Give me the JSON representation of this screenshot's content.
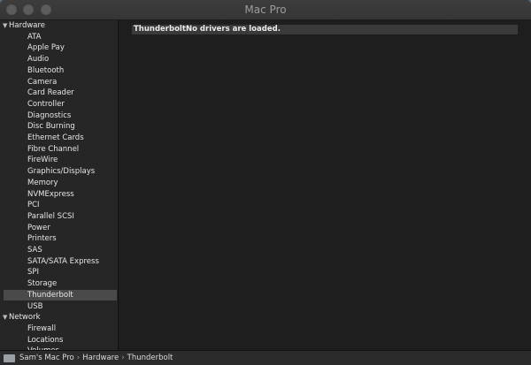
{
  "window": {
    "title": "Mac Pro"
  },
  "sidebar": {
    "groups": [
      {
        "label": "Hardware",
        "expanded": true,
        "items": [
          "ATA",
          "Apple Pay",
          "Audio",
          "Bluetooth",
          "Camera",
          "Card Reader",
          "Controller",
          "Diagnostics",
          "Disc Burning",
          "Ethernet Cards",
          "Fibre Channel",
          "FireWire",
          "Graphics/Displays",
          "Memory",
          "NVMExpress",
          "PCI",
          "Parallel SCSI",
          "Power",
          "Printers",
          "SAS",
          "SATA/SATA Express",
          "SPI",
          "Storage",
          "Thunderbolt",
          "USB"
        ]
      },
      {
        "label": "Network",
        "expanded": true,
        "items": [
          "Firewall",
          "Locations",
          "Volumes"
        ]
      }
    ],
    "selected": "Thunderbolt"
  },
  "main": {
    "info_key": "Thunderbolt:",
    "info_value": "No drivers are loaded."
  },
  "pathbar": {
    "crumbs": [
      "Sam's Mac Pro",
      "Hardware",
      "Thunderbolt"
    ],
    "icon": "computer-icon"
  }
}
